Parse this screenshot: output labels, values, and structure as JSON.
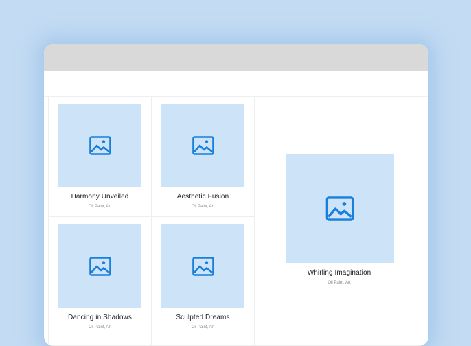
{
  "colors": {
    "background": "#c3dbf3",
    "thumbnail": "#cce3f8",
    "icon": "#1a7fdb",
    "titlebar": "#d9d9d9"
  },
  "gallery": {
    "items": [
      {
        "title": "Harmony Unveiled",
        "subtitle": "Oil Paint, Art",
        "icon": "image-icon"
      },
      {
        "title": "Aesthetic Fusion",
        "subtitle": "Oil Paint, Art",
        "icon": "image-icon"
      },
      {
        "title": "Whirling Imagination",
        "subtitle": "Oil Paint, Art",
        "icon": "image-icon"
      },
      {
        "title": "Dancing in Shadows",
        "subtitle": "Oil Paint, Art",
        "icon": "image-icon"
      },
      {
        "title": "Sculpted Dreams",
        "subtitle": "Oil Paint, Art",
        "icon": "image-icon"
      }
    ]
  }
}
